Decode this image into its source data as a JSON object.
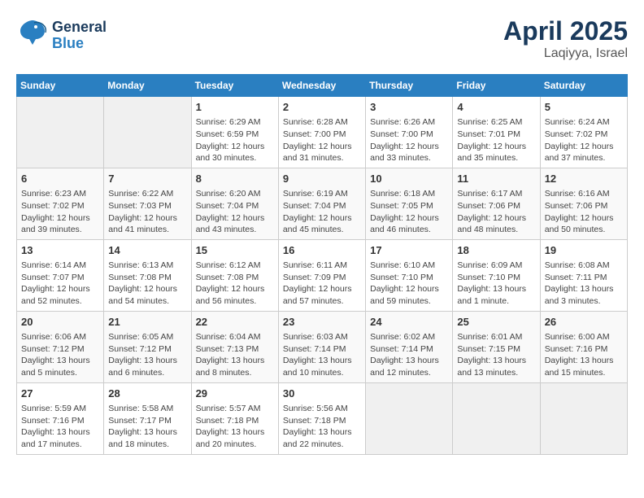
{
  "header": {
    "logo_line1": "General",
    "logo_line2": "Blue",
    "title": "April 2025",
    "subtitle": "Laqiyya, Israel"
  },
  "weekdays": [
    "Sunday",
    "Monday",
    "Tuesday",
    "Wednesday",
    "Thursday",
    "Friday",
    "Saturday"
  ],
  "weeks": [
    [
      {
        "day": "",
        "info": ""
      },
      {
        "day": "",
        "info": ""
      },
      {
        "day": "1",
        "info": "Sunrise: 6:29 AM\nSunset: 6:59 PM\nDaylight: 12 hours\nand 30 minutes."
      },
      {
        "day": "2",
        "info": "Sunrise: 6:28 AM\nSunset: 7:00 PM\nDaylight: 12 hours\nand 31 minutes."
      },
      {
        "day": "3",
        "info": "Sunrise: 6:26 AM\nSunset: 7:00 PM\nDaylight: 12 hours\nand 33 minutes."
      },
      {
        "day": "4",
        "info": "Sunrise: 6:25 AM\nSunset: 7:01 PM\nDaylight: 12 hours\nand 35 minutes."
      },
      {
        "day": "5",
        "info": "Sunrise: 6:24 AM\nSunset: 7:02 PM\nDaylight: 12 hours\nand 37 minutes."
      }
    ],
    [
      {
        "day": "6",
        "info": "Sunrise: 6:23 AM\nSunset: 7:02 PM\nDaylight: 12 hours\nand 39 minutes."
      },
      {
        "day": "7",
        "info": "Sunrise: 6:22 AM\nSunset: 7:03 PM\nDaylight: 12 hours\nand 41 minutes."
      },
      {
        "day": "8",
        "info": "Sunrise: 6:20 AM\nSunset: 7:04 PM\nDaylight: 12 hours\nand 43 minutes."
      },
      {
        "day": "9",
        "info": "Sunrise: 6:19 AM\nSunset: 7:04 PM\nDaylight: 12 hours\nand 45 minutes."
      },
      {
        "day": "10",
        "info": "Sunrise: 6:18 AM\nSunset: 7:05 PM\nDaylight: 12 hours\nand 46 minutes."
      },
      {
        "day": "11",
        "info": "Sunrise: 6:17 AM\nSunset: 7:06 PM\nDaylight: 12 hours\nand 48 minutes."
      },
      {
        "day": "12",
        "info": "Sunrise: 6:16 AM\nSunset: 7:06 PM\nDaylight: 12 hours\nand 50 minutes."
      }
    ],
    [
      {
        "day": "13",
        "info": "Sunrise: 6:14 AM\nSunset: 7:07 PM\nDaylight: 12 hours\nand 52 minutes."
      },
      {
        "day": "14",
        "info": "Sunrise: 6:13 AM\nSunset: 7:08 PM\nDaylight: 12 hours\nand 54 minutes."
      },
      {
        "day": "15",
        "info": "Sunrise: 6:12 AM\nSunset: 7:08 PM\nDaylight: 12 hours\nand 56 minutes."
      },
      {
        "day": "16",
        "info": "Sunrise: 6:11 AM\nSunset: 7:09 PM\nDaylight: 12 hours\nand 57 minutes."
      },
      {
        "day": "17",
        "info": "Sunrise: 6:10 AM\nSunset: 7:10 PM\nDaylight: 12 hours\nand 59 minutes."
      },
      {
        "day": "18",
        "info": "Sunrise: 6:09 AM\nSunset: 7:10 PM\nDaylight: 13 hours\nand 1 minute."
      },
      {
        "day": "19",
        "info": "Sunrise: 6:08 AM\nSunset: 7:11 PM\nDaylight: 13 hours\nand 3 minutes."
      }
    ],
    [
      {
        "day": "20",
        "info": "Sunrise: 6:06 AM\nSunset: 7:12 PM\nDaylight: 13 hours\nand 5 minutes."
      },
      {
        "day": "21",
        "info": "Sunrise: 6:05 AM\nSunset: 7:12 PM\nDaylight: 13 hours\nand 6 minutes."
      },
      {
        "day": "22",
        "info": "Sunrise: 6:04 AM\nSunset: 7:13 PM\nDaylight: 13 hours\nand 8 minutes."
      },
      {
        "day": "23",
        "info": "Sunrise: 6:03 AM\nSunset: 7:14 PM\nDaylight: 13 hours\nand 10 minutes."
      },
      {
        "day": "24",
        "info": "Sunrise: 6:02 AM\nSunset: 7:14 PM\nDaylight: 13 hours\nand 12 minutes."
      },
      {
        "day": "25",
        "info": "Sunrise: 6:01 AM\nSunset: 7:15 PM\nDaylight: 13 hours\nand 13 minutes."
      },
      {
        "day": "26",
        "info": "Sunrise: 6:00 AM\nSunset: 7:16 PM\nDaylight: 13 hours\nand 15 minutes."
      }
    ],
    [
      {
        "day": "27",
        "info": "Sunrise: 5:59 AM\nSunset: 7:16 PM\nDaylight: 13 hours\nand 17 minutes."
      },
      {
        "day": "28",
        "info": "Sunrise: 5:58 AM\nSunset: 7:17 PM\nDaylight: 13 hours\nand 18 minutes."
      },
      {
        "day": "29",
        "info": "Sunrise: 5:57 AM\nSunset: 7:18 PM\nDaylight: 13 hours\nand 20 minutes."
      },
      {
        "day": "30",
        "info": "Sunrise: 5:56 AM\nSunset: 7:18 PM\nDaylight: 13 hours\nand 22 minutes."
      },
      {
        "day": "",
        "info": ""
      },
      {
        "day": "",
        "info": ""
      },
      {
        "day": "",
        "info": ""
      }
    ]
  ]
}
